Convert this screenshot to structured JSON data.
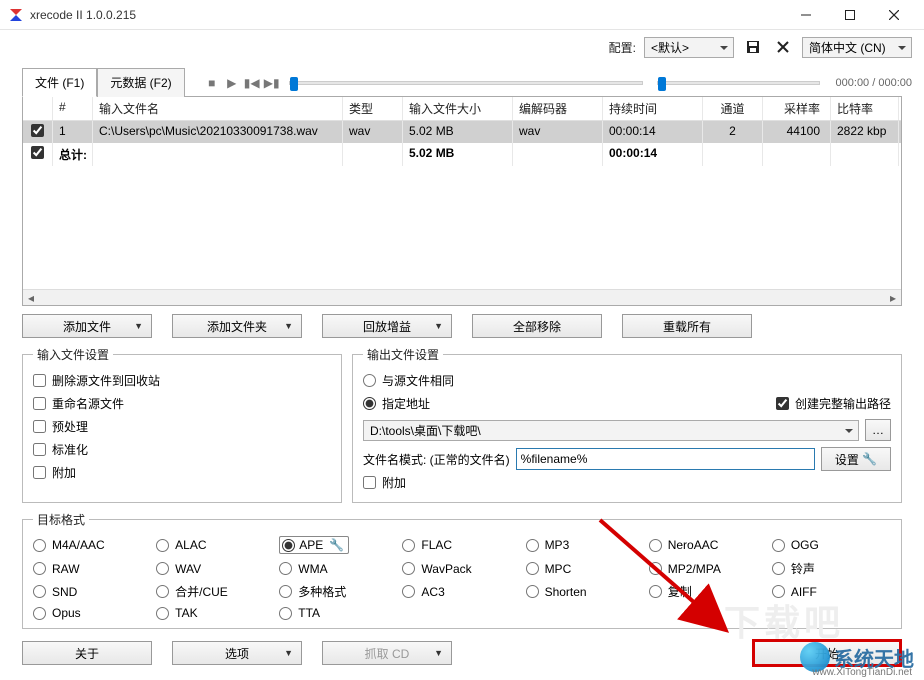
{
  "window": {
    "title": "xrecode II 1.0.0.215"
  },
  "config": {
    "label": "配置:",
    "profile": "<默认>",
    "language": "简体中文 (CN)"
  },
  "tabs": {
    "files": "文件 (F1)",
    "meta": "元数据 (F2)"
  },
  "player": {
    "time": "000:00 / 000:00"
  },
  "grid": {
    "headers": {
      "num": "#",
      "filename": "输入文件名",
      "type": "类型",
      "insize": "输入文件大小",
      "codec": "编解码器",
      "duration": "持续时间",
      "channels": "通道",
      "samplerate": "采样率",
      "bitrate": "比特率"
    },
    "row": {
      "num": "1",
      "filename": "C:\\Users\\pc\\Music\\20210330091738.wav",
      "type": "wav",
      "insize": "5.02 MB",
      "codec": "wav",
      "duration": "00:00:14",
      "channels": "2",
      "samplerate": "44100",
      "bitrate": "2822 kbp"
    },
    "total": {
      "label": "总计:",
      "insize": "5.02 MB",
      "duration": "00:00:14"
    }
  },
  "buttons": {
    "add_file": "添加文件",
    "add_folder": "添加文件夹",
    "replay_gain": "回放增益",
    "remove_all": "全部移除",
    "reload_all": "重载所有",
    "about": "关于",
    "options": "选项",
    "grab_cd": "抓取 CD",
    "start": "开始",
    "settings": "设置"
  },
  "input_settings": {
    "legend": "输入文件设置",
    "del_to_recycle": "删除源文件到回收站",
    "rename_src": "重命名源文件",
    "preprocess": "预处理",
    "normalize": "标准化",
    "append": "附加"
  },
  "output_settings": {
    "legend": "输出文件设置",
    "same_as_src": "与源文件相同",
    "specified": "指定地址",
    "create_full_path": "创建完整输出路径",
    "path": "D:\\tools\\桌面\\下载吧\\",
    "pattern_label": "文件名模式: (正常的文件名)",
    "pattern_value": "%filename%",
    "append": "附加"
  },
  "formats": {
    "legend": "目标格式",
    "items": [
      [
        "M4A/AAC",
        "ALAC",
        "APE",
        "FLAC",
        "MP3",
        "NeroAAC",
        "OGG"
      ],
      [
        "RAW",
        "WAV",
        "WMA",
        "WavPack",
        "MPC",
        "MP2/MPA",
        "铃声"
      ],
      [
        "SND",
        "合并/CUE",
        "多种格式",
        "AC3",
        "Shorten",
        "复制",
        "AIFF"
      ],
      [
        "Opus",
        "TAK",
        "TTA",
        "",
        "",
        "",
        ""
      ]
    ],
    "selected": "APE"
  },
  "watermark": {
    "text": "系统天地",
    "url": "www.XiTongTianDi.net"
  }
}
